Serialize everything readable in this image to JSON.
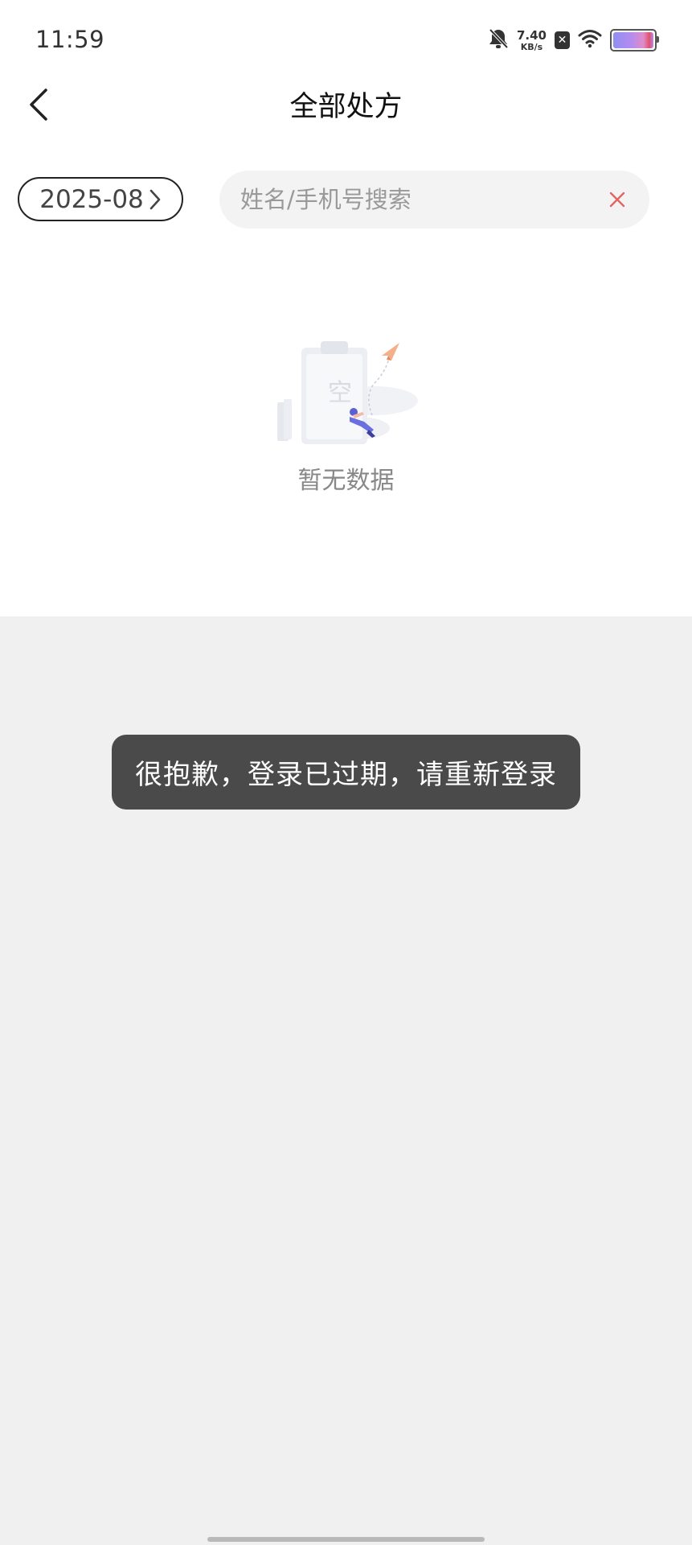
{
  "status_bar": {
    "time": "11:59",
    "net_speed_value": "7.40",
    "net_speed_unit": "KB/s",
    "icons": [
      "bell-muted-icon",
      "sim-disabled-icon",
      "wifi-icon",
      "battery-icon"
    ]
  },
  "header": {
    "title": "全部处方",
    "back_icon": "chevron-left-icon"
  },
  "filters": {
    "month": "2025-08",
    "search": {
      "placeholder": "姓名/手机号搜索",
      "value": ""
    }
  },
  "empty_state": {
    "illustration_text": "空",
    "message": "暂无数据"
  },
  "toast": {
    "message": "很抱歉，登录已过期，请重新登录"
  },
  "colors": {
    "toast_bg": "#4a4a4a",
    "clear_icon": "#e06666",
    "page_bg": "#f0f0f0",
    "content_bg": "#ffffff"
  }
}
